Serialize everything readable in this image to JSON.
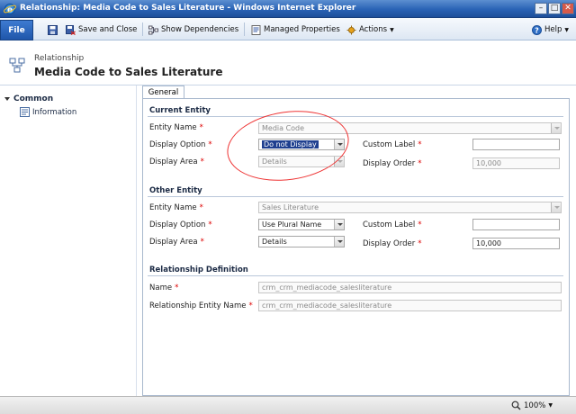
{
  "window": {
    "title": "Relationship: Media Code to Sales Literature - Windows Internet Explorer",
    "minimize_icon": "minimize-icon",
    "maximize_icon": "maximize-icon",
    "close_icon": "close-icon"
  },
  "toolbar": {
    "file_label": "File",
    "save_icon": "save-icon",
    "save_close_label": "Save and Close",
    "show_dependencies_label": "Show Dependencies",
    "managed_properties_label": "Managed Properties",
    "actions_label": "Actions",
    "help_label": "Help"
  },
  "header": {
    "entity_type": "Relationship",
    "title": "Media Code to Sales Literature"
  },
  "nav": {
    "category": "Common",
    "items": [
      {
        "label": "Information"
      }
    ]
  },
  "tabs": [
    {
      "label": "General"
    }
  ],
  "current_entity": {
    "section_title": "Current Entity",
    "entity_name_label": "Entity Name",
    "entity_name_value": "Media Code",
    "display_option_label": "Display Option",
    "display_option_value": "Do not Display",
    "display_area_label": "Display Area",
    "display_area_value": "Details",
    "custom_label_label": "Custom Label",
    "custom_label_value": "",
    "display_order_label": "Display Order",
    "display_order_value": "10,000"
  },
  "other_entity": {
    "section_title": "Other Entity",
    "entity_name_label": "Entity Name",
    "entity_name_value": "Sales Literature",
    "display_option_label": "Display Option",
    "display_option_value": "Use Plural Name",
    "display_area_label": "Display Area",
    "display_area_value": "Details",
    "custom_label_label": "Custom Label",
    "custom_label_value": "",
    "display_order_label": "Display Order",
    "display_order_value": "10,000"
  },
  "relationship_definition": {
    "section_title": "Relationship Definition",
    "name_label": "Name",
    "name_value": "crm_crm_mediacode_salesliterature",
    "entity_name_label": "Relationship Entity Name",
    "entity_name_value": "crm_crm_mediacode_salesliterature"
  },
  "required_marker": "*",
  "status": {
    "zoom": "100%"
  },
  "colors": {
    "title_bar": "#2a63b5",
    "required": "#dd0000",
    "annotation": "#ee3333"
  }
}
